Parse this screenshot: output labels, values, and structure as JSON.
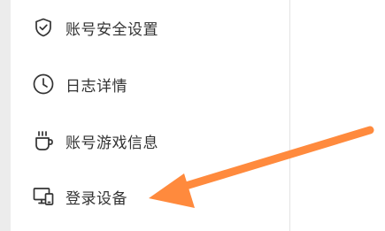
{
  "sidebar": {
    "items": [
      {
        "label": "账号安全设置",
        "icon": "shield-check-icon"
      },
      {
        "label": "日志详情",
        "icon": "clock-icon"
      },
      {
        "label": "账号游戏信息",
        "icon": "coffee-cup-icon"
      },
      {
        "label": "登录设备",
        "icon": "devices-icon"
      }
    ]
  },
  "annotation": {
    "arrow_color": "#ff8a3d",
    "points_to": "登录设备"
  },
  "colors": {
    "text": "#333333",
    "sidebar_bg": "#ffffff",
    "page_bg": "#f3f3f3"
  }
}
